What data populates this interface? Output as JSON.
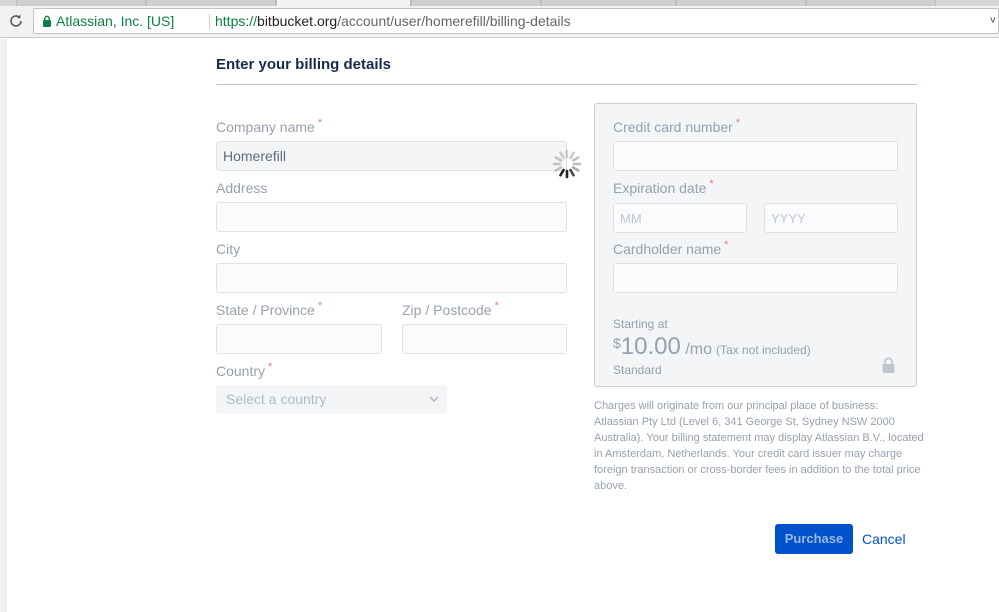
{
  "browser": {
    "reload_icon": "reload-icon",
    "security_icon": "lock-icon",
    "org_label": "Atlassian, Inc. [US]",
    "url_scheme": "https://",
    "url_host": "bitbucket.org",
    "url_path": "/account/user/homerefill/billing-details",
    "menu_caret": "˅"
  },
  "page": {
    "title": "Enter your billing details"
  },
  "form": {
    "required_marker": "*",
    "company_label": "Company name",
    "company_value": "Homerefill",
    "address_label": "Address",
    "city_label": "City",
    "state_label": "State / Province",
    "zip_label": "Zip / Postcode",
    "country_label": "Country",
    "country_selected": "Select a country"
  },
  "card": {
    "number_label": "Credit card number",
    "expiry_label": "Expiration date",
    "month_placeholder": "MM",
    "year_placeholder": "YYYY",
    "holder_label": "Cardholder name",
    "starting_at": "Starting at",
    "currency": "$",
    "amount": "10.00",
    "period": "/mo",
    "tax_note": "(Tax not included)",
    "plan": "Standard"
  },
  "disclaimer": "Charges will originate from our principal place of business: Atlassian Pty Ltd (Level 6, 341 George St, Sydney NSW 2000 Australia). Your billing statement may display Atlassian B.V., located in Amsterdam, Netherlands. Your credit card issuer may charge foreign transaction or cross-border fees in addition to the total price above.",
  "actions": {
    "purchase_label": "Purchase",
    "cancel_label": "Cancel"
  },
  "colors": {
    "primary": "#0052cc",
    "heading": "#172b4d",
    "muted": "#97a0af",
    "required": "#e37e7e",
    "secure_green": "#0b8043"
  }
}
